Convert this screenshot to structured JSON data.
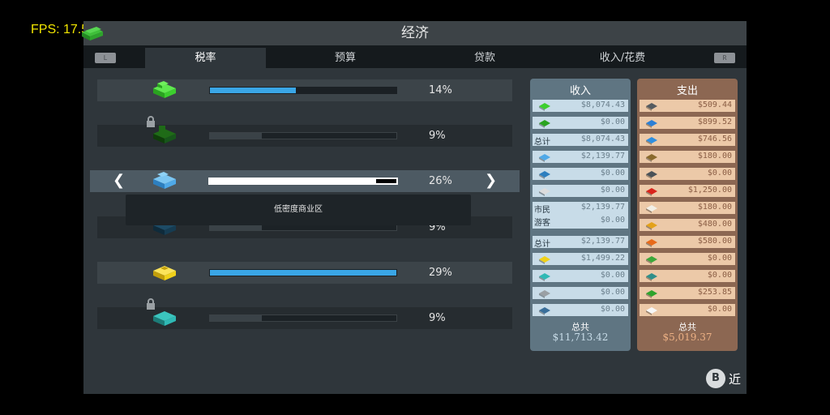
{
  "fps": "FPS: 17.5",
  "window": {
    "title": "经济"
  },
  "tabs": [
    {
      "label": "税率",
      "active": true
    },
    {
      "label": "预算",
      "active": false
    },
    {
      "label": "贷款",
      "active": false
    },
    {
      "label": "收入/花费",
      "active": false
    }
  ],
  "bumpers": {
    "left": "L",
    "right": "R"
  },
  "tax_rows": [
    {
      "zone": "residential-low",
      "pct": "14%",
      "value": 0.14,
      "locked": false
    },
    {
      "zone": "residential-high",
      "pct": "9%",
      "value": 0.09,
      "locked": true
    },
    {
      "zone": "commercial-low",
      "pct": "26%",
      "value": 0.26,
      "locked": false,
      "selected": true
    },
    {
      "zone": "commercial-high",
      "pct": "9%",
      "value": 0.09,
      "locked": true
    },
    {
      "zone": "industrial",
      "pct": "29%",
      "value": 0.29,
      "locked": false
    },
    {
      "zone": "office",
      "pct": "9%",
      "value": 0.09,
      "locked": true
    }
  ],
  "tooltip": "低密度商业区",
  "income": {
    "title": "收入",
    "lines": [
      {
        "icon": "residential-low-icon",
        "value": "$8,074.43"
      },
      {
        "icon": "residential-high-icon",
        "value": "$0.00"
      },
      {
        "label": "总计",
        "value": "$8,074.43"
      },
      {
        "icon": "commercial-low-icon",
        "value": "$2,139.77"
      },
      {
        "icon": "commercial-high-icon",
        "value": "$0.00"
      },
      {
        "icon": "leisure-icon",
        "value": "$0.00"
      },
      {
        "label": "市民",
        "value": "$2,139.77",
        "label2": "游客",
        "value2": "$0.00"
      },
      {
        "label": "总计",
        "value": "$2,139.77"
      },
      {
        "icon": "industrial-icon",
        "value": "$1,499.22"
      },
      {
        "icon": "office-icon",
        "value": "$0.00"
      },
      {
        "icon": "transport-icon",
        "value": "$0.00"
      },
      {
        "icon": "bus-icon",
        "value": "$0.00"
      }
    ],
    "total_label": "总共",
    "total_value": "$11,713.42"
  },
  "expense": {
    "title": "支出",
    "lines": [
      {
        "icon": "road-icon",
        "value": "$509.44"
      },
      {
        "icon": "electricity-icon",
        "value": "$899.52"
      },
      {
        "icon": "water-icon",
        "value": "$746.56"
      },
      {
        "icon": "garbage-icon",
        "value": "$180.00"
      },
      {
        "icon": "monument-icon",
        "value": "$0.00"
      },
      {
        "icon": "health-icon",
        "value": "$1,250.00"
      },
      {
        "icon": "education-icon",
        "value": "$180.00"
      },
      {
        "icon": "police-icon",
        "value": "$480.00"
      },
      {
        "icon": "fire-icon",
        "value": "$580.00"
      },
      {
        "icon": "park-icon",
        "value": "$0.00"
      },
      {
        "icon": "public-transport-icon",
        "value": "$0.00"
      },
      {
        "icon": "loan-icon",
        "value": "$253.85"
      },
      {
        "icon": "policy-icon",
        "value": "$0.00"
      }
    ],
    "total_label": "总共",
    "total_value": "$5,019.37"
  },
  "close": {
    "button": "B",
    "label": "近"
  },
  "colors": {
    "accent_blue": "#3aa6e6",
    "residential": "#3ccf2e",
    "commercial": "#4fa9e8",
    "industrial": "#f0d11a",
    "office": "#2fb9b5",
    "income_total": "#c8dce8",
    "expense_total": "#ecb084"
  }
}
